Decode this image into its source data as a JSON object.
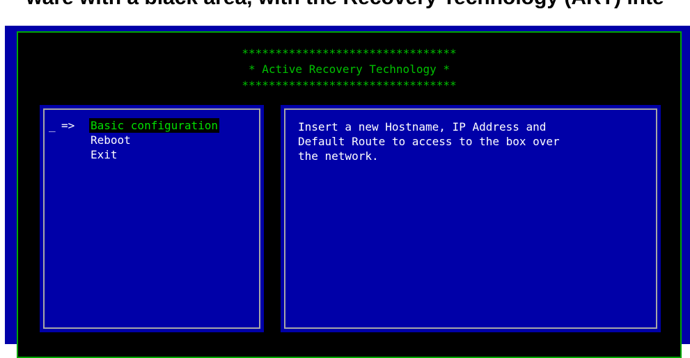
{
  "caption": "ware with a black area, with the Recovery Technology (ART) inte",
  "banner": {
    "stars_top": "********************************",
    "title": "* Active Recovery Technology *",
    "stars_bottom": "********************************"
  },
  "menu": {
    "cursor": "_",
    "pointer": "=>",
    "items": [
      {
        "label": "Basic configuration",
        "selected": true
      },
      {
        "label": "Reboot",
        "selected": false
      },
      {
        "label": "Exit",
        "selected": false
      }
    ]
  },
  "description": {
    "lines": [
      "Insert a new Hostname, IP Address and",
      "Default Route to access to the box over",
      "the network."
    ]
  },
  "colors": {
    "screen_bg": "#0000a8",
    "frame_border": "#00a800",
    "banner_text": "#00c000",
    "selected_text": "#00e000"
  }
}
